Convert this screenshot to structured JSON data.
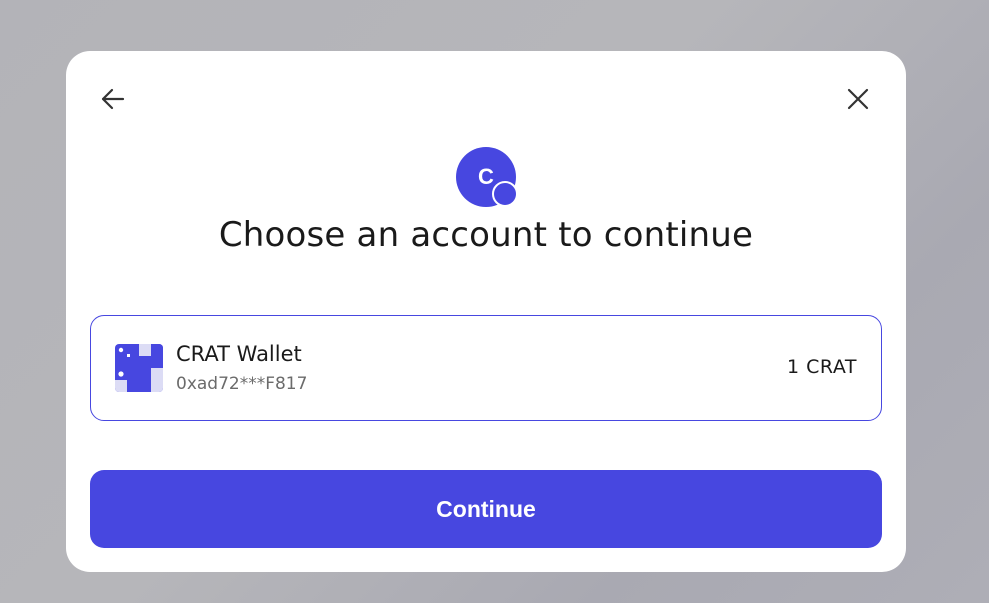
{
  "modal": {
    "title": "Choose an account to continue",
    "logo_letter": "C"
  },
  "account": {
    "name": "CRAT Wallet",
    "address": "0xad72***F817",
    "balance": "1 CRAT"
  },
  "actions": {
    "continue_label": "Continue"
  },
  "icons": {
    "back": "arrow-left-icon",
    "close": "close-icon",
    "logo": "app-logo-icon",
    "avatar": "wallet-identicon"
  },
  "colors": {
    "accent": "#4747e0",
    "backdrop": "#b3b3b8",
    "text_primary": "#1a1a1a",
    "text_secondary": "#6b6b6b"
  }
}
